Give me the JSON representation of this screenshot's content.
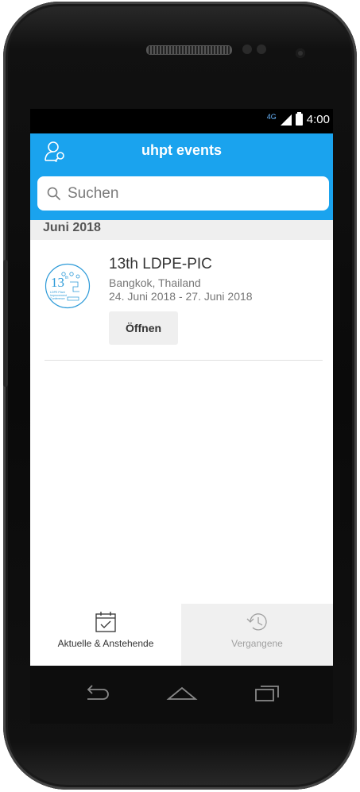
{
  "status_bar": {
    "network": "4G",
    "time": "4:00"
  },
  "app_bar": {
    "title": "uhpt events",
    "user_icon": "user-key-icon"
  },
  "search": {
    "placeholder": "Suchen",
    "value": "",
    "icon": "search-icon"
  },
  "sections": [
    {
      "header": "Juni 2018",
      "events": [
        {
          "title": "13th LDPE-PIC",
          "location": "Bangkok, Thailand",
          "dates": "24. Juni 2018 - 27. Juni 2018",
          "open_label": "Öffnen",
          "logo": {
            "number": "13",
            "suffix": "th",
            "caption": [
              "LDPE Plant",
              "Improvement",
              "Conference"
            ]
          }
        }
      ]
    }
  ],
  "tabs": [
    {
      "label": "Aktuelle & Anstehende",
      "icon": "calendar-check-icon",
      "active": true
    },
    {
      "label": "Vergangene",
      "icon": "history-icon",
      "active": false
    }
  ],
  "colors": {
    "primary": "#1aa3ee",
    "section_bg": "#efefef",
    "inactive_tab_bg": "#f0f0f0"
  },
  "nav_keys": [
    "back-icon",
    "home-icon",
    "recents-icon"
  ]
}
